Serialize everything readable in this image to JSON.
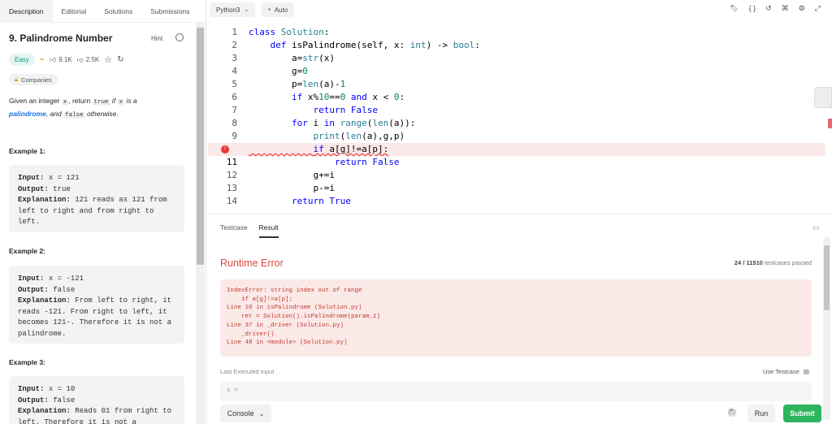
{
  "tabs": [
    "Description",
    "Editorial",
    "Solutions",
    "Submissions"
  ],
  "problem": {
    "title": "9. Palindrome Number",
    "hint": "Hint",
    "difficulty": "Easy",
    "likes": "9.1K",
    "dislikes": "2.5K",
    "companies": "Companies",
    "desc_1": "Given an integer ",
    "desc_x": "x",
    "desc_2": ", return ",
    "desc_true": "true",
    "desc_3": " if ",
    "desc_x2": "x",
    "desc_4": " is a",
    "desc_link": "palindrome",
    "desc_5": ", and ",
    "desc_false": "false",
    "desc_6": " otherwise."
  },
  "examples": [
    {
      "heading": "Example 1:",
      "input": "x = 121",
      "output": "true",
      "explanation": "121 reads as 121 from left to right and from right to left."
    },
    {
      "heading": "Example 2:",
      "input": "x = -121",
      "output": "false",
      "explanation": "From left to right, it reads -121. From right to left, it becomes 121-. Therefore it is not a palindrome."
    },
    {
      "heading": "Example 3:",
      "input": "x = 10",
      "output": "false",
      "explanation": "Reads 01 from right to left. Therefore it is not a"
    }
  ],
  "labels": {
    "input": "Input:",
    "output": "Output:",
    "explanation": "Explanation:"
  },
  "editor": {
    "language": "Python3",
    "mode": "Auto"
  },
  "code_lines": [
    {
      "n": "1",
      "text": "class Solution:"
    },
    {
      "n": "2",
      "text": "    def isPalindrome(self, x: int) -> bool:"
    },
    {
      "n": "3",
      "text": "        a=str(x)"
    },
    {
      "n": "4",
      "text": "        g=0"
    },
    {
      "n": "5",
      "text": "        p=len(a)-1"
    },
    {
      "n": "6",
      "text": "        if x%10==0 and x < 0:"
    },
    {
      "n": "7",
      "text": "            return False"
    },
    {
      "n": "8",
      "text": "        for i in range(len(a)):"
    },
    {
      "n": "9",
      "text": "            print(len(a),g,p)"
    },
    {
      "n": "",
      "text": "            if a[g]!=a[p]:"
    },
    {
      "n": "11",
      "text": "                return False"
    },
    {
      "n": "12",
      "text": "            g+=i"
    },
    {
      "n": "13",
      "text": "            p-=i"
    },
    {
      "n": "14",
      "text": "        return True"
    }
  ],
  "bottom": {
    "tabs": [
      "Testcase",
      "Result"
    ],
    "status": "Runtime Error",
    "passed_count": "24 / 11510",
    "passed_label": "testcases passed",
    "error_text": "IndexError: string index out of range\n    if a[g]!=a[p]:\nLine 10 in isPalindrome (Solution.py)\n    ret = Solution().isPalindrome(param_1)\nLine 37 in _driver (Solution.py)\n    _driver()\nLine 48 in <module> (Solution.py)",
    "last_input_label": "Last Executed Input",
    "use_testcase": "Use Testcase",
    "input_value": "x =",
    "console": "Console",
    "run": "Run",
    "submit": "Submit"
  },
  "colors": {
    "accent_green": "#2db55d",
    "error_red": "#d74a3d",
    "easy_teal": "#00a58a"
  }
}
